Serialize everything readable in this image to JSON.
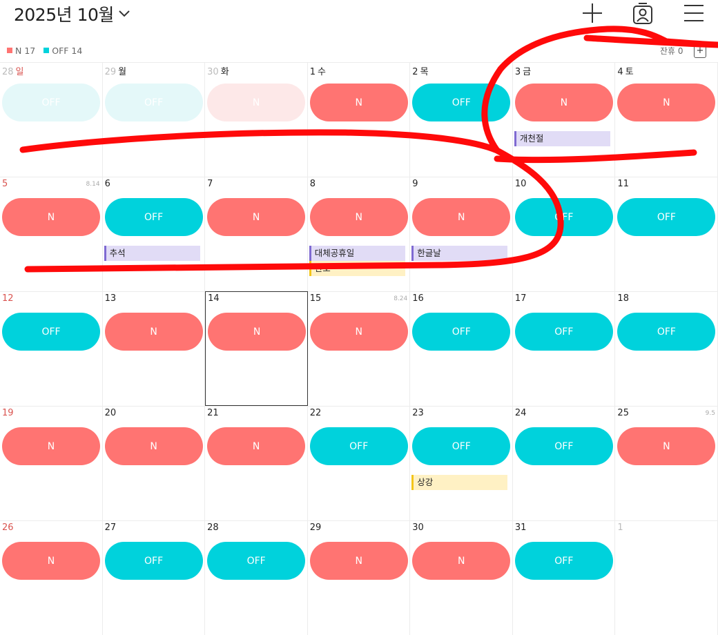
{
  "header": {
    "title": "2025년 10월",
    "icons": {
      "dropdown": "chevron-down-icon",
      "add": "plus-icon",
      "profile": "contact-card-icon",
      "menu": "hamburger-menu-icon"
    }
  },
  "legend": {
    "n": "N 17",
    "off": "OFF 14",
    "colors": {
      "N": "#ff7472",
      "OFF": "#00d2dc"
    },
    "leave": "잔휴 0",
    "leave_add": "+"
  },
  "days": [
    {
      "num": "28",
      "label": "일",
      "shift": "OFF",
      "faded": true,
      "sun": true,
      "other": true
    },
    {
      "num": "29",
      "label": "월",
      "shift": "OFF",
      "faded": true,
      "other": true
    },
    {
      "num": "30",
      "label": "화",
      "shift": "N",
      "faded": true,
      "other": true
    },
    {
      "num": "1",
      "label": "수",
      "shift": "N"
    },
    {
      "num": "2",
      "label": "목",
      "shift": "OFF"
    },
    {
      "num": "3",
      "label": "금",
      "shift": "N",
      "events": [
        {
          "type": "holiday",
          "text": "개천절"
        }
      ]
    },
    {
      "num": "4",
      "label": "토",
      "shift": "N"
    },
    {
      "num": "5",
      "shift": "N",
      "sun": true,
      "lunar": "8.14"
    },
    {
      "num": "6",
      "shift": "OFF",
      "events": [
        {
          "type": "holiday",
          "text": "추석"
        }
      ]
    },
    {
      "num": "7",
      "shift": "N"
    },
    {
      "num": "8",
      "shift": "N",
      "events": [
        {
          "type": "holiday",
          "text": "대체공휴일"
        },
        {
          "type": "memo",
          "text": "한호"
        }
      ]
    },
    {
      "num": "9",
      "shift": "N",
      "events": [
        {
          "type": "holiday",
          "text": "한글날"
        }
      ]
    },
    {
      "num": "10",
      "shift": "OFF"
    },
    {
      "num": "11",
      "shift": "OFF"
    },
    {
      "num": "12",
      "shift": "OFF",
      "sun": true
    },
    {
      "num": "13",
      "shift": "N"
    },
    {
      "num": "14",
      "shift": "N",
      "today": true
    },
    {
      "num": "15",
      "shift": "N",
      "lunar": "8.24"
    },
    {
      "num": "16",
      "shift": "OFF"
    },
    {
      "num": "17",
      "shift": "OFF"
    },
    {
      "num": "18",
      "shift": "OFF"
    },
    {
      "num": "19",
      "shift": "N",
      "sun": true
    },
    {
      "num": "20",
      "shift": "N"
    },
    {
      "num": "21",
      "shift": "N"
    },
    {
      "num": "22",
      "shift": "OFF"
    },
    {
      "num": "23",
      "shift": "OFF",
      "events": [
        {
          "type": "memo",
          "text": "상강"
        }
      ]
    },
    {
      "num": "24",
      "shift": "OFF"
    },
    {
      "num": "25",
      "shift": "N",
      "lunar": "9.5"
    },
    {
      "num": "26",
      "shift": "N",
      "sun": true
    },
    {
      "num": "27",
      "shift": "OFF"
    },
    {
      "num": "28",
      "shift": "OFF"
    },
    {
      "num": "29",
      "shift": "N"
    },
    {
      "num": "30",
      "shift": "N"
    },
    {
      "num": "31",
      "shift": "OFF"
    },
    {
      "num": "1",
      "other": true
    }
  ]
}
